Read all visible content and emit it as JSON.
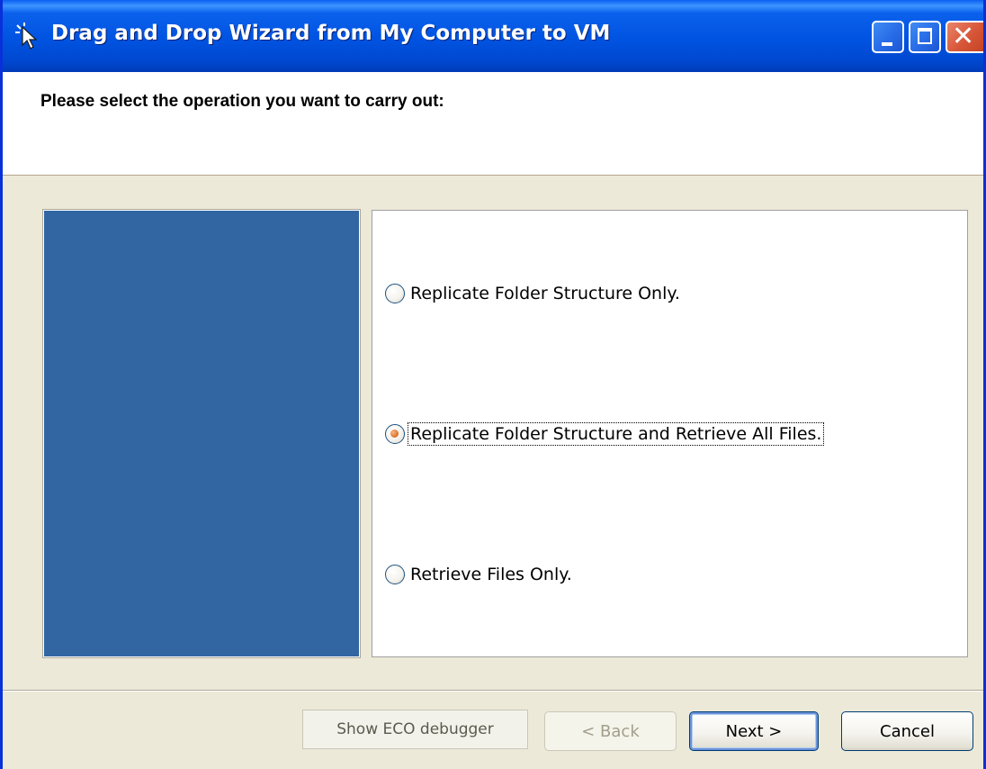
{
  "window": {
    "title": "Drag and Drop Wizard from My Computer to VM",
    "icon": "wand-cursor-icon",
    "controls": [
      "minimize",
      "maximize",
      "close"
    ]
  },
  "header": {
    "prompt": "Please select the operation you want to carry out:"
  },
  "options": [
    {
      "label": "Replicate Folder Structure Only.",
      "checked": false,
      "focused": false
    },
    {
      "label": "Replicate Folder Structure and Retrieve All Files.",
      "checked": true,
      "focused": true
    },
    {
      "label": "Retrieve Files Only.",
      "checked": false,
      "focused": false
    }
  ],
  "buttons": {
    "eco_debugger": "Show ECO debugger",
    "back": "< Back",
    "next": "Next >",
    "cancel": "Cancel"
  },
  "colors": {
    "title_bar": "#0053e1",
    "side_panel": "#3166a3",
    "dialog_bg": "#ece9d8",
    "radio_selected": "#e0782e"
  }
}
